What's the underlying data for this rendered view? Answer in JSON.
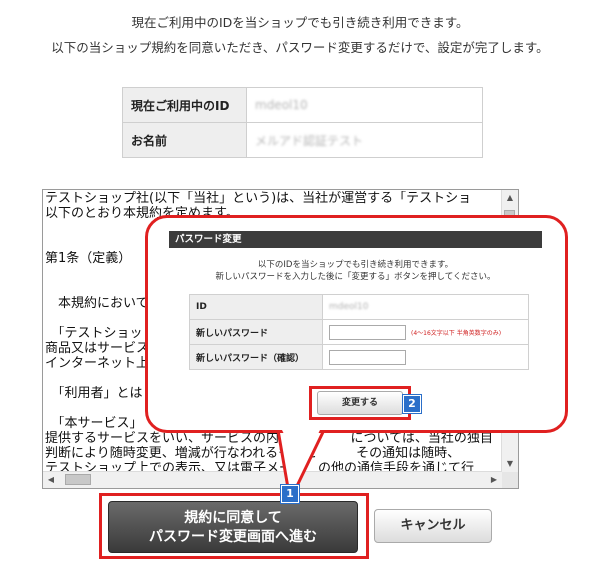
{
  "intro": {
    "line1": "現在ご利用中のIDを当ショップでも引き続き利用できます。",
    "line2": "以下の当ショップ規約を同意いただき、パスワード変更するだけで、設定が完了します。"
  },
  "account_info": {
    "rows": [
      {
        "label": "現在ご利用中のID",
        "value": "mdeol10"
      },
      {
        "label": "お名前",
        "value": "メルアド認証テスト"
      }
    ]
  },
  "terms": {
    "lines": [
      "テストショップ社(以下「当社」という)は、当社が運営する「テストショ",
      "以下のとおり本規約を定めます。",
      "",
      "",
      "第1条（定義）",
      "",
      "",
      "　本規約において",
      "",
      "　「テストショッ",
      "商品又はサービス",
      "インターネット上",
      "",
      "　「利用者」とは",
      "",
      "　「本サービス」",
      "提供するサービスをいい、サービスの内容、　　　　については、当社の独自",
      "判断により随時変更、増減が行なわれるものと　　　その通知は随時、",
      "テストショップ上での表示、又は電子メー　　の他の通信手段を通じて行"
    ]
  },
  "buttons": {
    "agree_line1": "規約に同意して",
    "agree_line2": "パスワード変更画面へ進む",
    "cancel": "キャンセル"
  },
  "popup": {
    "title": "パスワード変更",
    "message1": "以下のIDを当ショップでも引き続き利用できます。",
    "message2": "新しいパスワードを入力した後に「変更する」ボタンを押してください。",
    "rows": [
      {
        "label": "ID",
        "value": "mdeol10"
      },
      {
        "label": "新しいパスワード",
        "hint": "(4～16文字以下 半角英数字のみ)"
      },
      {
        "label": "新しいパスワード（確認）"
      }
    ],
    "change_button": "変更する"
  },
  "annotations": {
    "badge1": "1",
    "badge2": "2"
  },
  "colors": {
    "highlight": "#e02020",
    "badge": "#2b6fc9",
    "popup_title_bg": "#3c3c3c"
  }
}
